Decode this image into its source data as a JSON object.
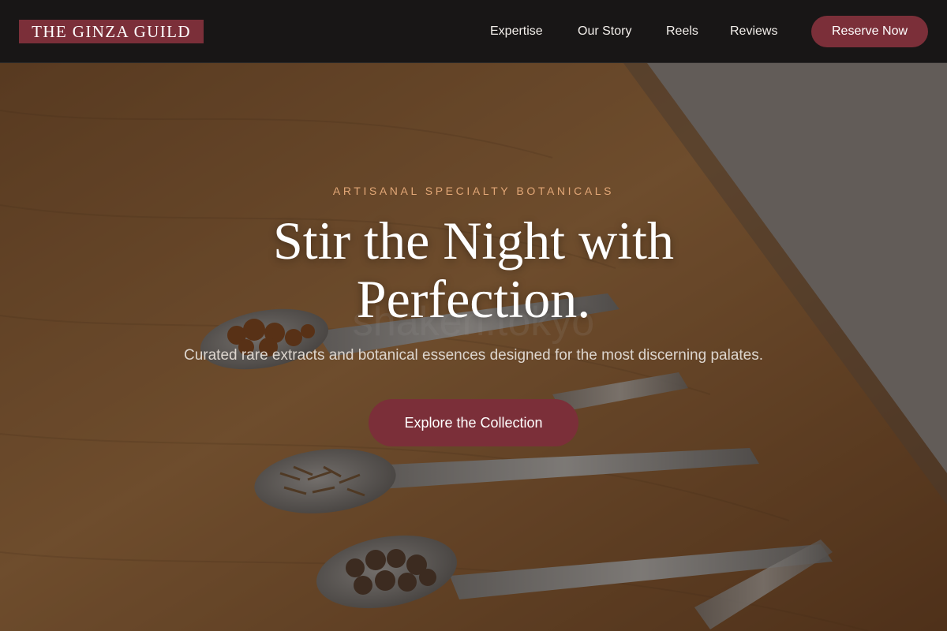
{
  "brand": {
    "logo_text": "THE GINZA GUILD",
    "accent_color": "#7b2f39",
    "eyebrow_color": "#e2a777"
  },
  "nav": {
    "links": [
      "Expertise",
      "Our Story",
      "Reels",
      "Reviews"
    ],
    "cta_label": "Reserve Now"
  },
  "hero": {
    "eyebrow": "ARTISANAL SPECIALTY BOTANICALS",
    "headline_line1": "Stir the Night with",
    "headline_line2": "Perfection.",
    "subtitle": "Curated rare extracts and botanical essences designed for the most discerning palates.",
    "cta_label": "Explore the Collection",
    "watermark_text": "shaken.tokyo"
  }
}
